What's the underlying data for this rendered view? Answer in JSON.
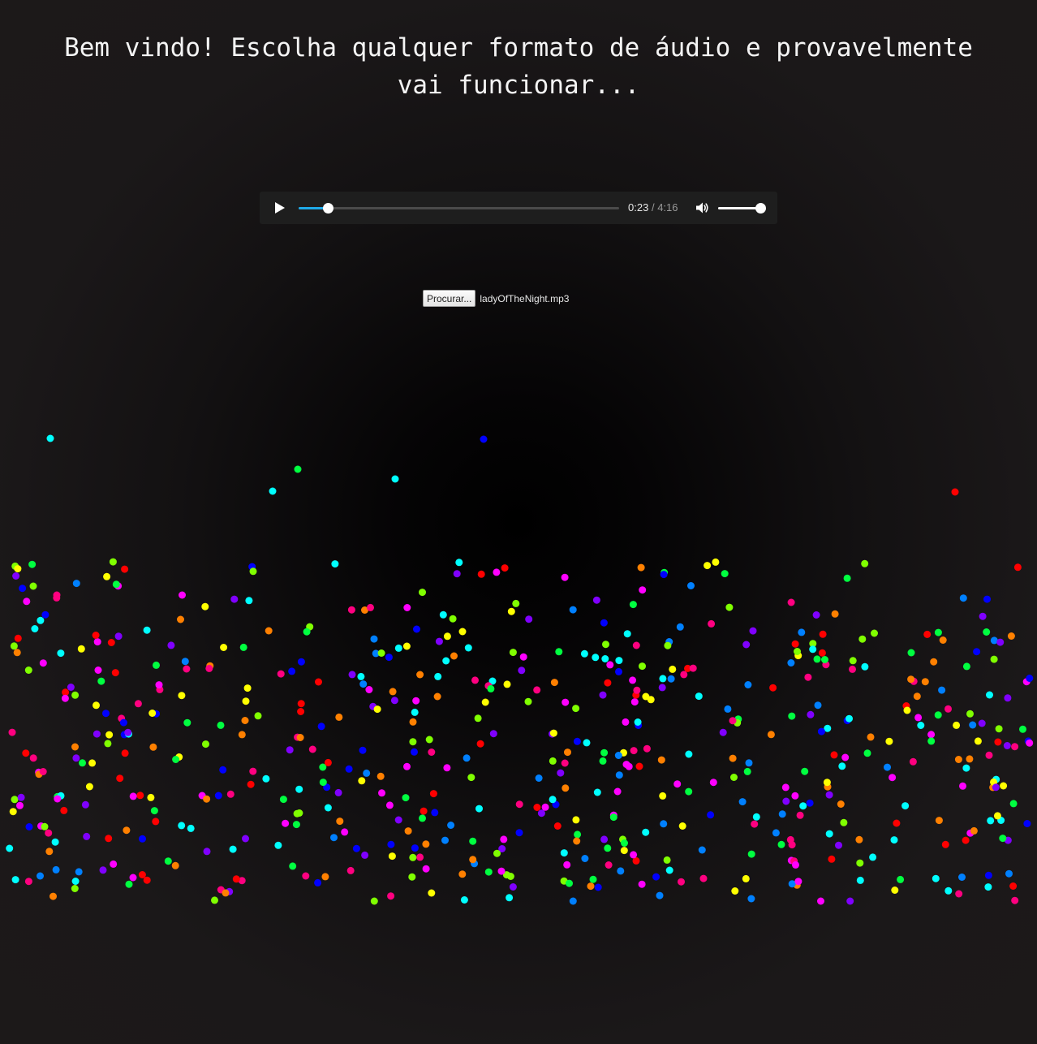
{
  "page": {
    "title": "Bem vindo! Escolha qualquer formato de áudio e provavelmente vai funcionar..."
  },
  "audio_player": {
    "current_time": "0:23",
    "separator": "/",
    "duration": "4:16",
    "progress": 0.09,
    "volume": 1.0,
    "play_icon": "play-icon",
    "volume_icon": "speaker-icon"
  },
  "file_input": {
    "button_label": "Procurar...",
    "file_name": "ladyOfTheNight.mp3"
  },
  "visualizer": {
    "palette": [
      "#ff0000",
      "#ff8000",
      "#ffff00",
      "#80ff00",
      "#00ff40",
      "#00ffff",
      "#0080ff",
      "#0000ff",
      "#8000ff",
      "#ff00ff",
      "#ff0080"
    ]
  }
}
